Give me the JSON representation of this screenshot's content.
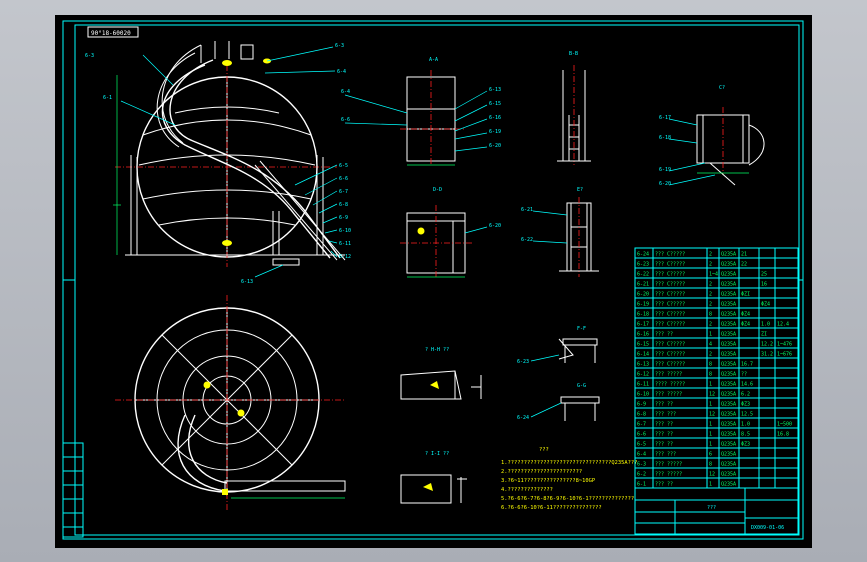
{
  "colors": {
    "background": "#000000",
    "frame": "#00ffff",
    "outline": "#ffffff",
    "centerline": "#ff2020",
    "dimension": "#00ff66",
    "table_text": "#00ff66",
    "table_lines": "#00ffff",
    "highlight": "#ffff00",
    "viewport": "#b5b9c0"
  },
  "drawing": {
    "spec_box": "90°18-60020",
    "title_block_name": "???",
    "drawing_number": "DX009-01-06"
  },
  "view_labels": {
    "a_a": "A-A",
    "b_b": "B-B",
    "c": "C?",
    "d_d": "D-D",
    "e": "E?",
    "f_f": "F-F",
    "g_g": "G-G",
    "h": "? H-H ??",
    "i": "? I-I ??"
  },
  "callouts": {
    "main_left": [
      "6-3",
      "6-1"
    ],
    "main_right": [
      "6-3",
      "6-4",
      "6-5",
      "6-6",
      "6-7",
      "6-8",
      "6-9",
      "6-10",
      "6-11",
      "6-12"
    ],
    "aa_left": [
      "6-4",
      "6-6"
    ],
    "aa_right": [
      "6-13",
      "6-15",
      "6-16",
      "6-19",
      "6-20"
    ],
    "c": [
      "6-17",
      "6-18",
      "6-19",
      "6-20"
    ],
    "dd": [
      "6-20",
      "6-21"
    ],
    "e": [
      "6-21",
      "6-22"
    ],
    "ff": "6-23",
    "gg": "6-24",
    "base": "6-13"
  },
  "notes": {
    "title": "???",
    "lines": [
      "1.????????????????????????????????Q235A???",
      "2.???????????????????????",
      "3.?6~11????????????????8~10GP",
      "4.??????????????",
      "5.?6-6?6-7?6-8?6-9?6-10?6-1??????????????",
      "6.?6-6?6-10?6-11???????????????"
    ]
  },
  "parts_table": {
    "rows": [
      [
        "6-24",
        "??? C?????",
        "2",
        "Q235A",
        "21",
        "",
        ""
      ],
      [
        "6-23",
        "??? C?????",
        "2",
        "Q235A",
        "22",
        "",
        ""
      ],
      [
        "6-22",
        "??? C?????",
        "1~4",
        "Q235A",
        "",
        "25",
        ""
      ],
      [
        "6-21",
        "??? C?????",
        "2",
        "Q235A",
        "",
        "16",
        ""
      ],
      [
        "6-20",
        "??? C?????",
        "2",
        "Q235A",
        "ΦZI",
        "",
        ""
      ],
      [
        "6-19",
        "??? C?????",
        "2",
        "Q235A",
        "",
        "ΦZ4",
        ""
      ],
      [
        "6-18",
        "??? C?????",
        "8",
        "Q235A",
        "ΦZ4",
        "",
        ""
      ],
      [
        "6-17",
        "??? C?????",
        "2",
        "Q235A",
        "ΦZ4",
        "1.0",
        "12.4"
      ],
      [
        "6-16",
        "??? ??",
        "1",
        "Q235A",
        "",
        "ZI",
        ""
      ],
      [
        "6-15",
        "??? C?????",
        "4",
        "Q235A",
        "",
        "12.2",
        "1~476"
      ],
      [
        "6-14",
        "??? C?????",
        "2",
        "Q235A",
        "",
        "31.2",
        "1~676"
      ],
      [
        "6-13",
        "??? C?????",
        "8",
        "Q235A",
        "16.7",
        "",
        ""
      ],
      [
        "6-12",
        "??? ?????",
        "8",
        "Q235A",
        "??",
        "",
        ""
      ],
      [
        "6-11",
        "???? ?????",
        "1",
        "Q235A",
        "14.6",
        "",
        ""
      ],
      [
        "6-10",
        "??? ?????",
        "12",
        "Q235A",
        "6.2",
        "",
        ""
      ],
      [
        "6-9",
        "??? ??",
        "1",
        "Q235A",
        "ΦZ3",
        "",
        ""
      ],
      [
        "6-8",
        "??? ???",
        "12",
        "Q235A",
        "12.5",
        "",
        ""
      ],
      [
        "6-7",
        "??? ??",
        "1",
        "Q235A",
        "1.0",
        "",
        "1~500"
      ],
      [
        "6-6",
        "??? ??",
        "1",
        "Q235A",
        "8.5",
        "",
        "16.8"
      ],
      [
        "6-5",
        "??? ??",
        "1",
        "Q235A",
        "ΦZ3",
        "",
        ""
      ],
      [
        "6-4",
        "??? ???",
        "6",
        "Q235A",
        "",
        "",
        ""
      ],
      [
        "6-3",
        "??? ?????",
        "8",
        "Q235A",
        "",
        "",
        ""
      ],
      [
        "6-2",
        "??? ?????",
        "12",
        "Q235A",
        "",
        "",
        ""
      ],
      [
        "6-1",
        "??? ??",
        "1",
        "Q235A",
        "",
        "",
        ""
      ]
    ]
  }
}
